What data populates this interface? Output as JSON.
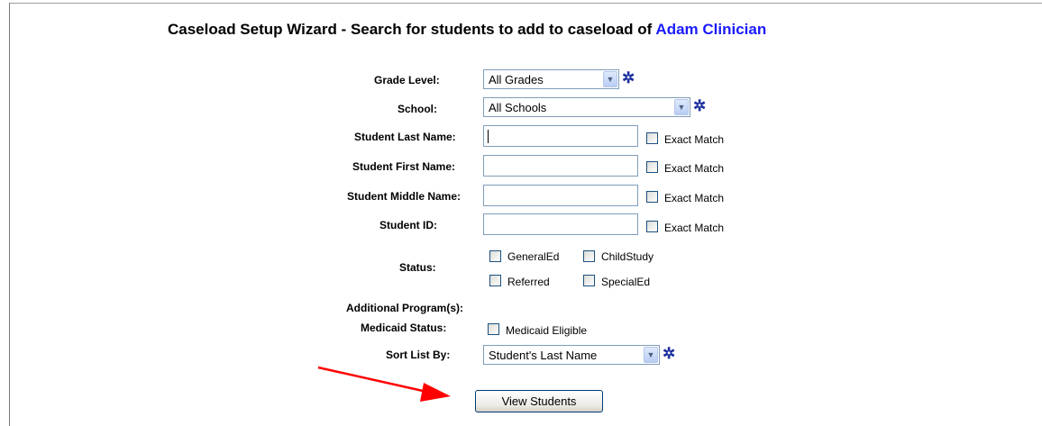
{
  "title": {
    "prefix": "Caseload Setup Wizard - Search for students to add to caseload of ",
    "user": "Adam Clinician"
  },
  "form": {
    "grade_level": {
      "label": "Grade Level:",
      "value": "All Grades"
    },
    "school": {
      "label": "School:",
      "value": "All Schools"
    },
    "last_name": {
      "label": "Student Last Name:",
      "value": "",
      "exact": "Exact Match"
    },
    "first_name": {
      "label": "Student First Name:",
      "value": "",
      "exact": "Exact Match"
    },
    "middle_name": {
      "label": "Student Middle Name:",
      "value": "",
      "exact": "Exact Match"
    },
    "student_id": {
      "label": "Student ID:",
      "value": "",
      "exact": "Exact Match"
    },
    "status": {
      "label": "Status:",
      "options": [
        "GeneralEd",
        "ChildStudy",
        "Referred",
        "SpecialEd"
      ]
    },
    "additional_programs": {
      "label": "Additional Program(s):"
    },
    "medicaid": {
      "label": "Medicaid Status:",
      "option": "Medicaid Eligible"
    },
    "sort": {
      "label": "Sort List By:",
      "value": "Student's Last Name"
    }
  },
  "view_button": "View Students",
  "colors": {
    "user_name": "#1a1aff",
    "required_marker": "#1c2fa0",
    "annotation_arrow": "#ff0000"
  },
  "icons": {
    "required": "required-asterisk-icon",
    "dropdown": "chevron-down-icon"
  }
}
